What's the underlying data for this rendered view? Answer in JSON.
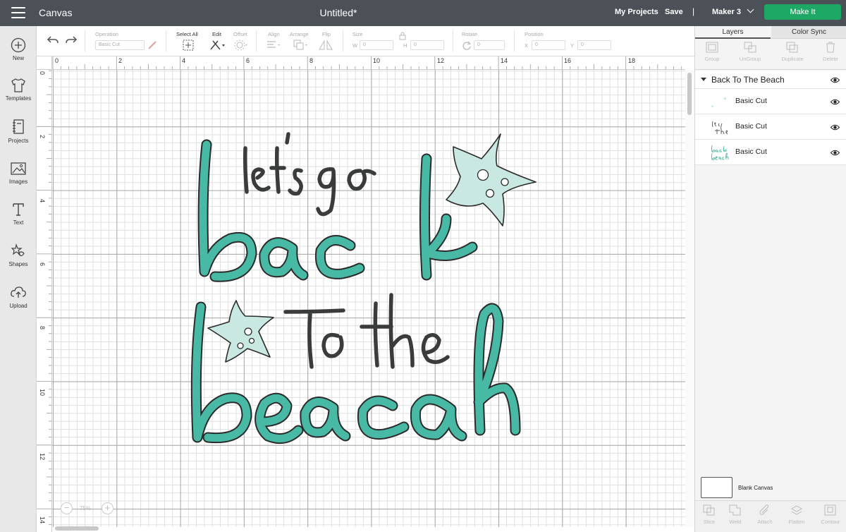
{
  "app": {
    "title": "Canvas",
    "document_title": "Untitled*"
  },
  "topbar": {
    "my_projects": "My Projects",
    "save": "Save",
    "separator": "|",
    "machine": "Maker 3",
    "make_it": "Make It"
  },
  "sidebar": {
    "items": [
      {
        "label": "New",
        "icon": "plus-icon"
      },
      {
        "label": "Templates",
        "icon": "tshirt-icon"
      },
      {
        "label": "Projects",
        "icon": "notebook-icon"
      },
      {
        "label": "Images",
        "icon": "image-icon"
      },
      {
        "label": "Text",
        "icon": "text-icon"
      },
      {
        "label": "Shapes",
        "icon": "shapes-icon"
      },
      {
        "label": "Upload",
        "icon": "upload-icon"
      }
    ]
  },
  "toolbar": {
    "operation_label": "Operation",
    "operation_value": "Basic Cut",
    "select_all": "Select All",
    "edit": "Edit",
    "offset": "Offset",
    "align": "Align",
    "arrange": "Arrange",
    "flip": "Flip",
    "size": "Size",
    "w": "W",
    "h": "H",
    "w_value": "0",
    "h_value": "0",
    "rotate": "Rotate",
    "rotate_value": "0",
    "position": "Position",
    "x": "X",
    "y": "Y",
    "x_value": "0",
    "y_value": "0"
  },
  "ruler": {
    "top": [
      "0",
      "2",
      "4",
      "6",
      "8",
      "10",
      "12",
      "14",
      "16",
      "18",
      "2"
    ],
    "left": [
      "0",
      "2",
      "4",
      "6",
      "8",
      "10",
      "12",
      "14"
    ]
  },
  "zoom": {
    "value": "75%",
    "minus": "−",
    "plus": "+"
  },
  "layers_panel": {
    "tabs": [
      "Layers",
      "Color Sync"
    ],
    "tools": [
      "Group",
      "UnGroup",
      "Duplicate",
      "Delete"
    ],
    "group_name": "Back To The Beach",
    "layers": [
      {
        "name": "Basic Cut",
        "thumb": "starfish"
      },
      {
        "name": "Basic Cut",
        "thumb": "lets-go-to-the"
      },
      {
        "name": "Basic Cut",
        "thumb": "back-beach"
      }
    ],
    "blank_canvas": "Blank Canvas",
    "bottom_tools": [
      "Slice",
      "Weld",
      "Attach",
      "Flatten",
      "Contour"
    ]
  },
  "artwork": {
    "lines": [
      "let's go",
      "back",
      "to the",
      "beach"
    ],
    "colors": {
      "teal": "#47b9a5",
      "dark": "#3a3b3b",
      "starfish": "#c9e8e2",
      "outline": "#2b2b2b"
    }
  }
}
